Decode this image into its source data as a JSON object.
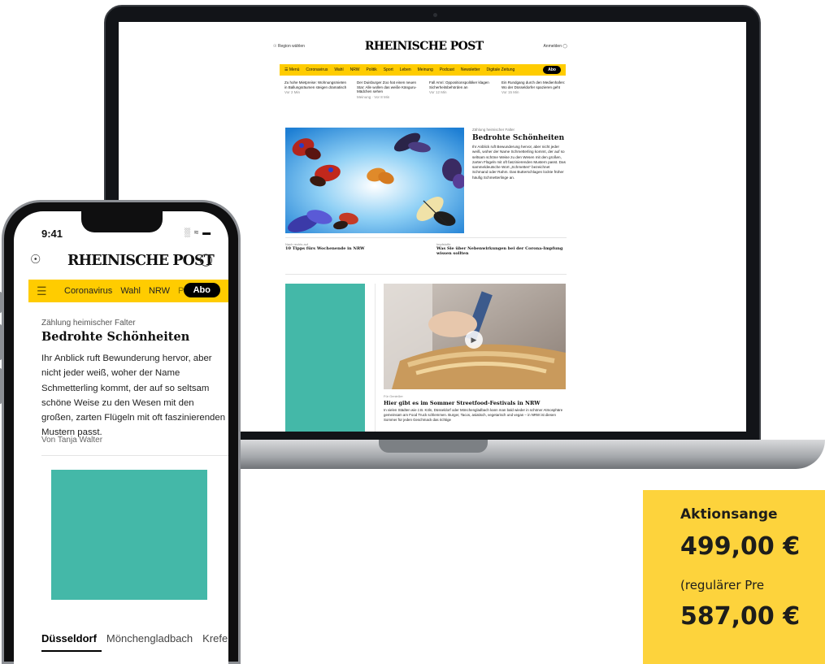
{
  "laptop_site": {
    "region_label": "Region wählen",
    "logo": "RHEINISCHE POST",
    "login_label": "Anmelden",
    "nav": {
      "menu_label": "Menü",
      "items": [
        "Coronavirus",
        "Wahl",
        "NRW",
        "Politik",
        "Sport",
        "Leben",
        "Meinung",
        "Podcast",
        "Newsletter",
        "Digitale Zeitung"
      ],
      "abo_label": "Abo"
    },
    "teasers": [
      {
        "text": "Zu hohe Mietpreise: Wohnungsmieten in Ballungsräumen steigen dramatisch",
        "meta": "Vor 2 Min"
      },
      {
        "text": "Der Duisburger Zoo hat einen neuen Star: Alle wollen das weiße Känguru-Mädchen sehen",
        "meta": "Meinung · Vor 8 Min"
      },
      {
        "text": "Fall Amri: Oppositionspolitiker klagen Sicherheitsbehörden an",
        "meta": "Vor 12 Min"
      },
      {
        "text": "Ein Rundgang durch den Medienhafen: Wo der Düsseldorfer spazieren geht",
        "meta": "Vor 15 Min"
      }
    ],
    "hero": {
      "kicker": "Zählung heimischer Falter",
      "title": "Bedrohte Schönheiten",
      "body": "Ihr Anblick ruft Bewunderung hervor, aber nicht jeder weiß, woher der Name Schmetterling kommt, der auf so seltsam schöne Weise zu den Wesen mit den großen, zarten Flügeln mit oft faszinierenden Mustern passt. Das sammeldeutsche Wort „Schmetten“ bezeichnet Schmand oder Rahm. Das Butterschlagen lockte früher häufig Schmetterlinge an."
    },
    "sub_teasers": [
      {
        "kicker": "Nach rechts auf",
        "title": "10 Tipps fürs Wochenende in NRW"
      },
      {
        "kicker": "Impfstoffe",
        "title": "Was Sie über Nebenwirkungen bei der Corona-Impfung wissen sollten"
      }
    ],
    "food": {
      "kicker": "Für Genießer",
      "title": "Hier gibt es im Sommer Streetfood-Festivals in NRW",
      "body": "In vielen Städten wie z.B. Köln, Düsseldorf oder Mönchengladbach kann man bald wieder in schöner Atmosphäre gemeinsam am Food Truck schlemmen. Burger, Tacos, asiatisch, vegetarisch und vegan – in NRW ist diesen Sommer für jeden Geschmack das richtige"
    }
  },
  "phone": {
    "status_time": "9:41",
    "logo": "RHEINISCHE POST",
    "nav_items": [
      "Coronavirus",
      "Wahl",
      "NRW",
      "Po"
    ],
    "abo_label": "Abo",
    "kicker": "Zählung heimischer Falter",
    "title": "Bedrohte Schönheiten",
    "body": "Ihr Anblick ruft Bewunderung hervor, aber nicht jeder weiß, woher der Name Schmetterling kommt, der auf so seltsam schöne Weise zu den Wesen mit den großen, zarten Flügeln mit oft faszinierenden Mustern passt.",
    "author": "Von Tanja Walter",
    "tabs": [
      "Düsseldorf",
      "Mönchengladbach",
      "Krefe"
    ]
  },
  "promo": {
    "title": "Aktionsange",
    "price": "499,00 €",
    "regular_label": "(regulärer Pre",
    "old_price": "587,00 €"
  },
  "colors": {
    "brand_yellow": "#ffcc00",
    "teal": "#44b8a8",
    "promo_yellow": "#fdd33c"
  }
}
